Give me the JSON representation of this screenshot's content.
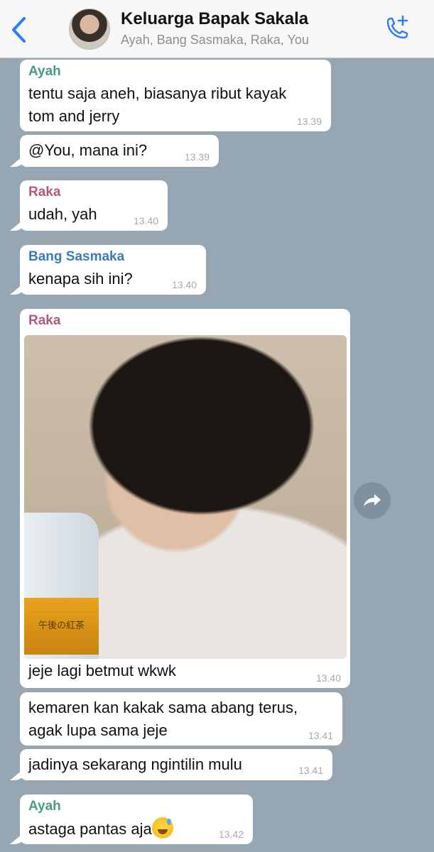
{
  "header": {
    "title": "Keluarga Bapak Sakala",
    "subtitle": "Ayah, Bang Sasmaka, Raka, You"
  },
  "colors": {
    "ayah": "#4a9a8a",
    "raka": "#b2587f",
    "bang_sasmaka": "#3b7ac0",
    "accent": "#2f7cf6",
    "chat_background": "#97a6b3"
  },
  "messages": [
    {
      "sender": "Ayah",
      "text_line1": "tentu saja aneh, biasanya ribut kayak",
      "text_line2": "tom and jerry",
      "time": "13.39"
    },
    {
      "text": "@You, mana ini?",
      "time": "13.39"
    },
    {
      "sender": "Raka",
      "text": "udah, yah",
      "time": "13.40"
    },
    {
      "sender": "Bang Sasmaka",
      "text": "kenapa sih ini?",
      "time": "13.40"
    },
    {
      "sender": "Raka",
      "caption": "jeje lagi betmut wkwk",
      "time": "13.40",
      "bottle_label": "午後の紅茶"
    },
    {
      "text_line1": "kemaren kan kakak sama abang terus,",
      "text_line2": "agak lupa sama jeje",
      "time": "13.41"
    },
    {
      "text": "jadinya sekarang ngintilin mulu",
      "time": "13.41"
    },
    {
      "sender": "Ayah",
      "text": "astaga pantas aja",
      "time": "13.42"
    }
  ],
  "icons": {
    "back": "chevron-left-icon",
    "call": "phone-plus-icon",
    "share": "forward-arrow-icon",
    "emoji": "grinning-face-with-sweat-emoji"
  }
}
